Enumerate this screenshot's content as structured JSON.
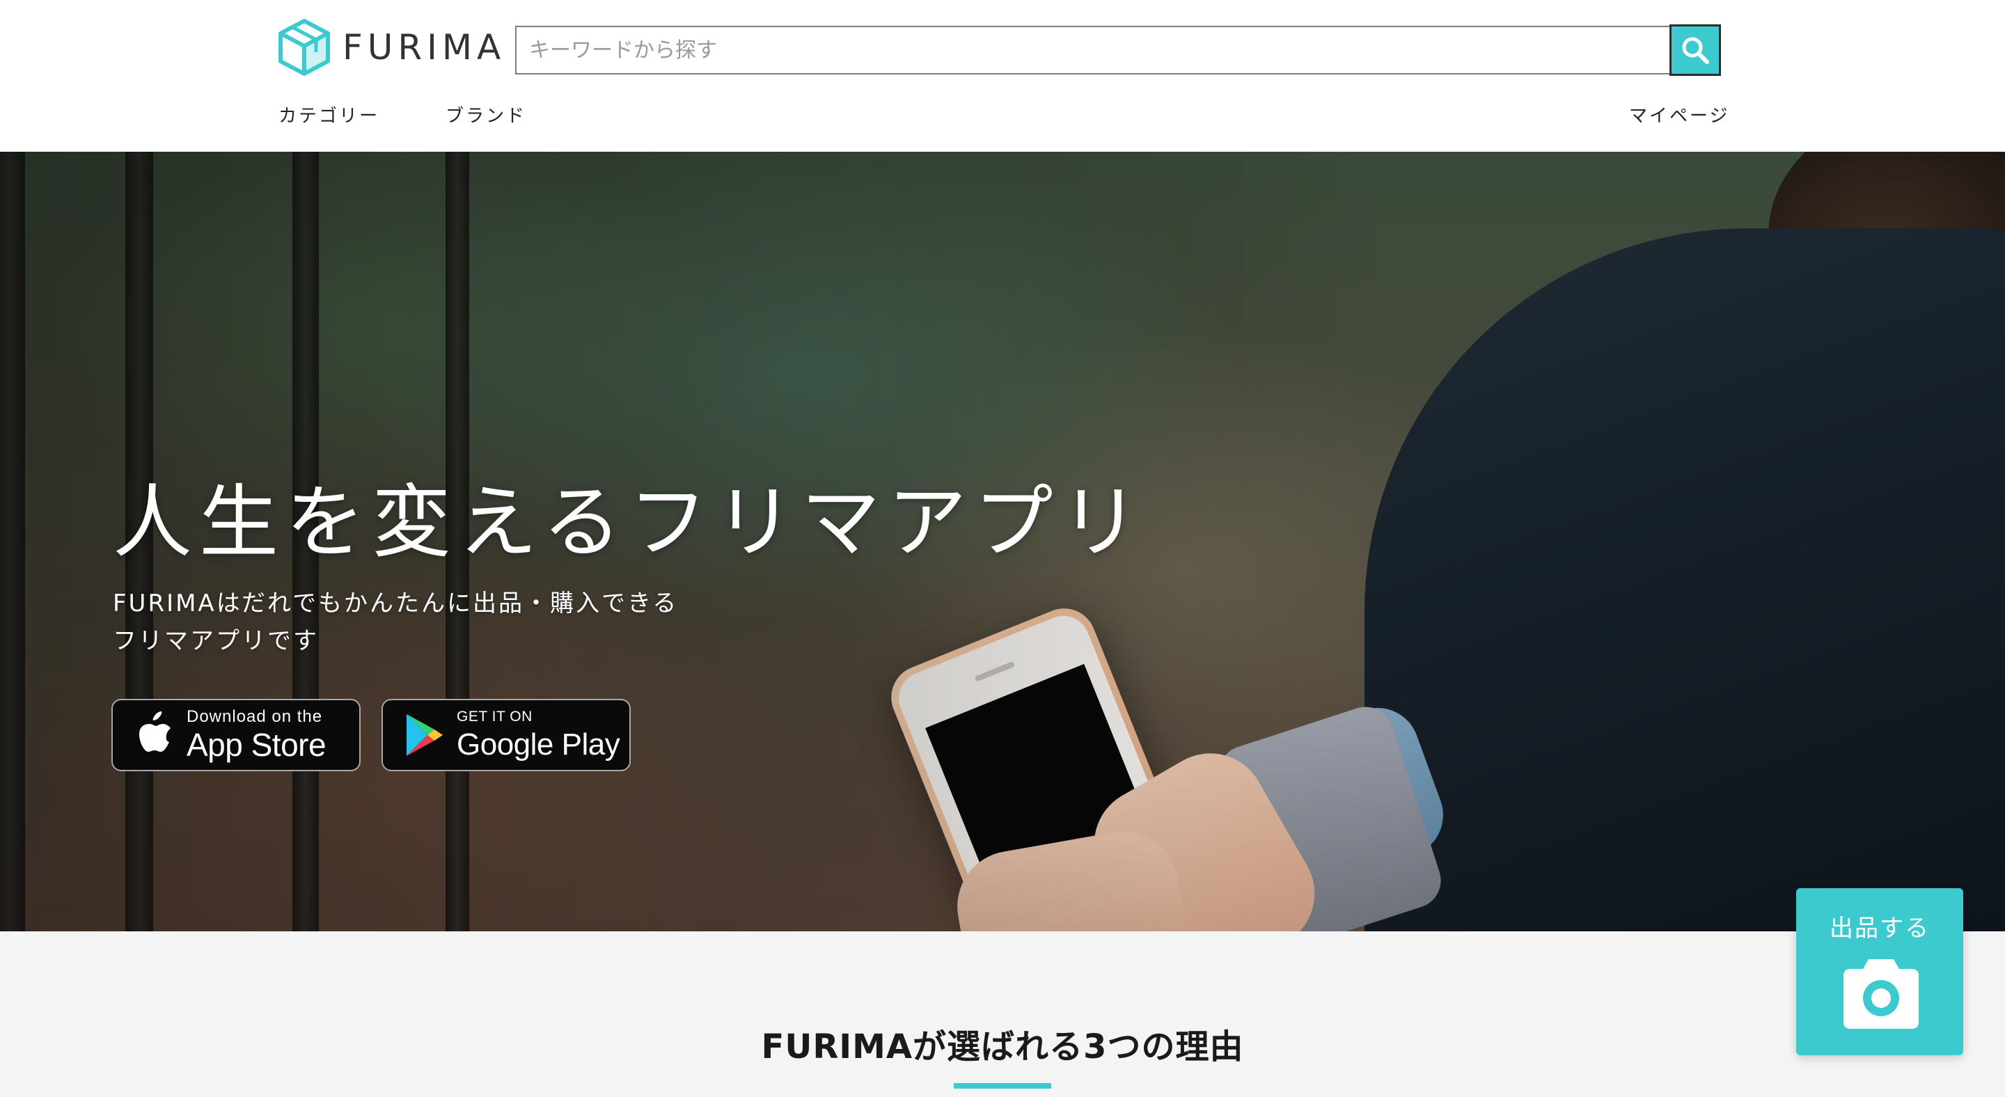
{
  "header": {
    "logo_text": "FURIMA",
    "search": {
      "placeholder": "キーワードから探す",
      "value": ""
    },
    "nav": {
      "category": "カテゴリー",
      "brand": "ブランド",
      "mypage": "マイページ"
    }
  },
  "hero": {
    "title": "人生を変えるフリマアプリ",
    "subtitle_line1": "FURIMAはだれでもかんたんに出品・購入できる",
    "subtitle_line2": "フリマアプリです",
    "app_store": {
      "small": "Download on the",
      "large": "App Store"
    },
    "google_play": {
      "small": "GET IT ON",
      "large": "Google Play"
    }
  },
  "features": {
    "title": "FURIMAが選ばれる3つの理由"
  },
  "sell_button": {
    "label": "出品する"
  },
  "colors": {
    "accent": "#3ccace",
    "text_dark": "#1a1a1a",
    "section_bg": "#f4f4f4"
  },
  "icons": {
    "logo": "cube-logo-icon",
    "search": "search-icon",
    "app_store": "apple-icon",
    "google_play": "google-play-icon",
    "sell": "camera-icon"
  }
}
